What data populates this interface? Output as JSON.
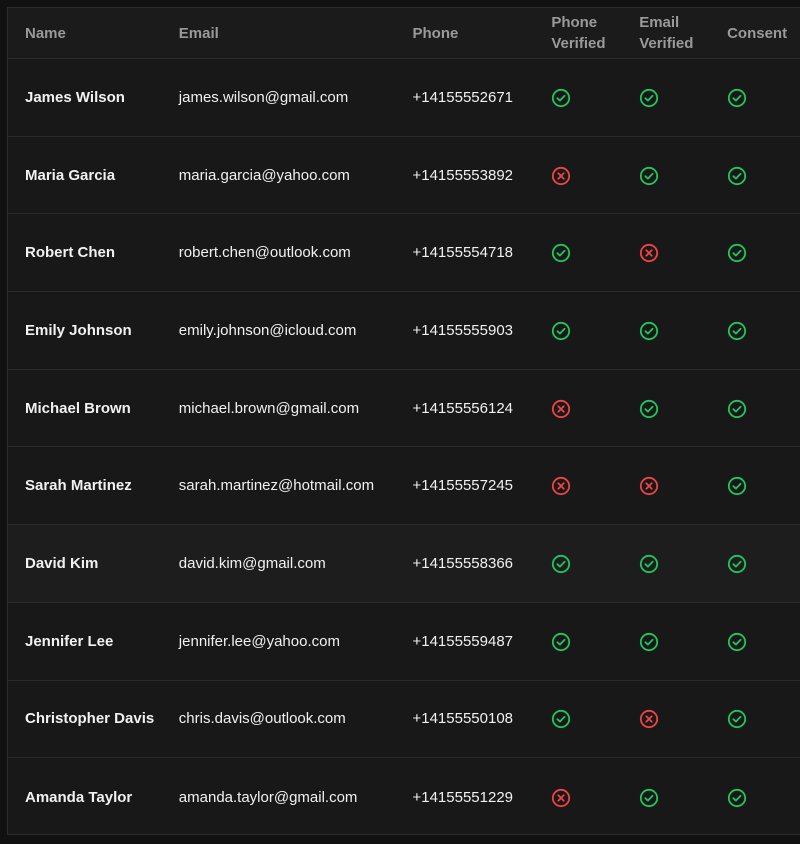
{
  "colors": {
    "verified": "#22c55e",
    "unverified": "#ef4444"
  },
  "table": {
    "headers": {
      "name": "Name",
      "email": "Email",
      "phone": "Phone",
      "phone_verified": "Phone Verified",
      "email_verified": "Email Verified",
      "consent": "Consent"
    },
    "rows": [
      {
        "name": "James Wilson",
        "email": "james.wilson@gmail.com",
        "phone": "+14155552671",
        "phone_verified": true,
        "email_verified": true,
        "consent": true
      },
      {
        "name": "Maria Garcia",
        "email": "maria.garcia@yahoo.com",
        "phone": "+14155553892",
        "phone_verified": false,
        "email_verified": true,
        "consent": true
      },
      {
        "name": "Robert Chen",
        "email": "robert.chen@outlook.com",
        "phone": "+14155554718",
        "phone_verified": true,
        "email_verified": false,
        "consent": true
      },
      {
        "name": "Emily Johnson",
        "email": "emily.johnson@icloud.com",
        "phone": "+14155555903",
        "phone_verified": true,
        "email_verified": true,
        "consent": true
      },
      {
        "name": "Michael Brown",
        "email": "michael.brown@gmail.com",
        "phone": "+14155556124",
        "phone_verified": false,
        "email_verified": true,
        "consent": true
      },
      {
        "name": "Sarah Martinez",
        "email": "sarah.martinez@hotmail.com",
        "phone": "+14155557245",
        "phone_verified": false,
        "email_verified": false,
        "consent": true
      },
      {
        "name": "David Kim",
        "email": "david.kim@gmail.com",
        "phone": "+14155558366",
        "phone_verified": true,
        "email_verified": true,
        "consent": true
      },
      {
        "name": "Jennifer Lee",
        "email": "jennifer.lee@yahoo.com",
        "phone": "+14155559487",
        "phone_verified": true,
        "email_verified": true,
        "consent": true
      },
      {
        "name": "Christopher Davis",
        "email": "chris.davis@outlook.com",
        "phone": "+14155550108",
        "phone_verified": true,
        "email_verified": false,
        "consent": true
      },
      {
        "name": "Amanda Taylor",
        "email": "amanda.taylor@gmail.com",
        "phone": "+14155551229",
        "phone_verified": false,
        "email_verified": true,
        "consent": true
      }
    ]
  }
}
